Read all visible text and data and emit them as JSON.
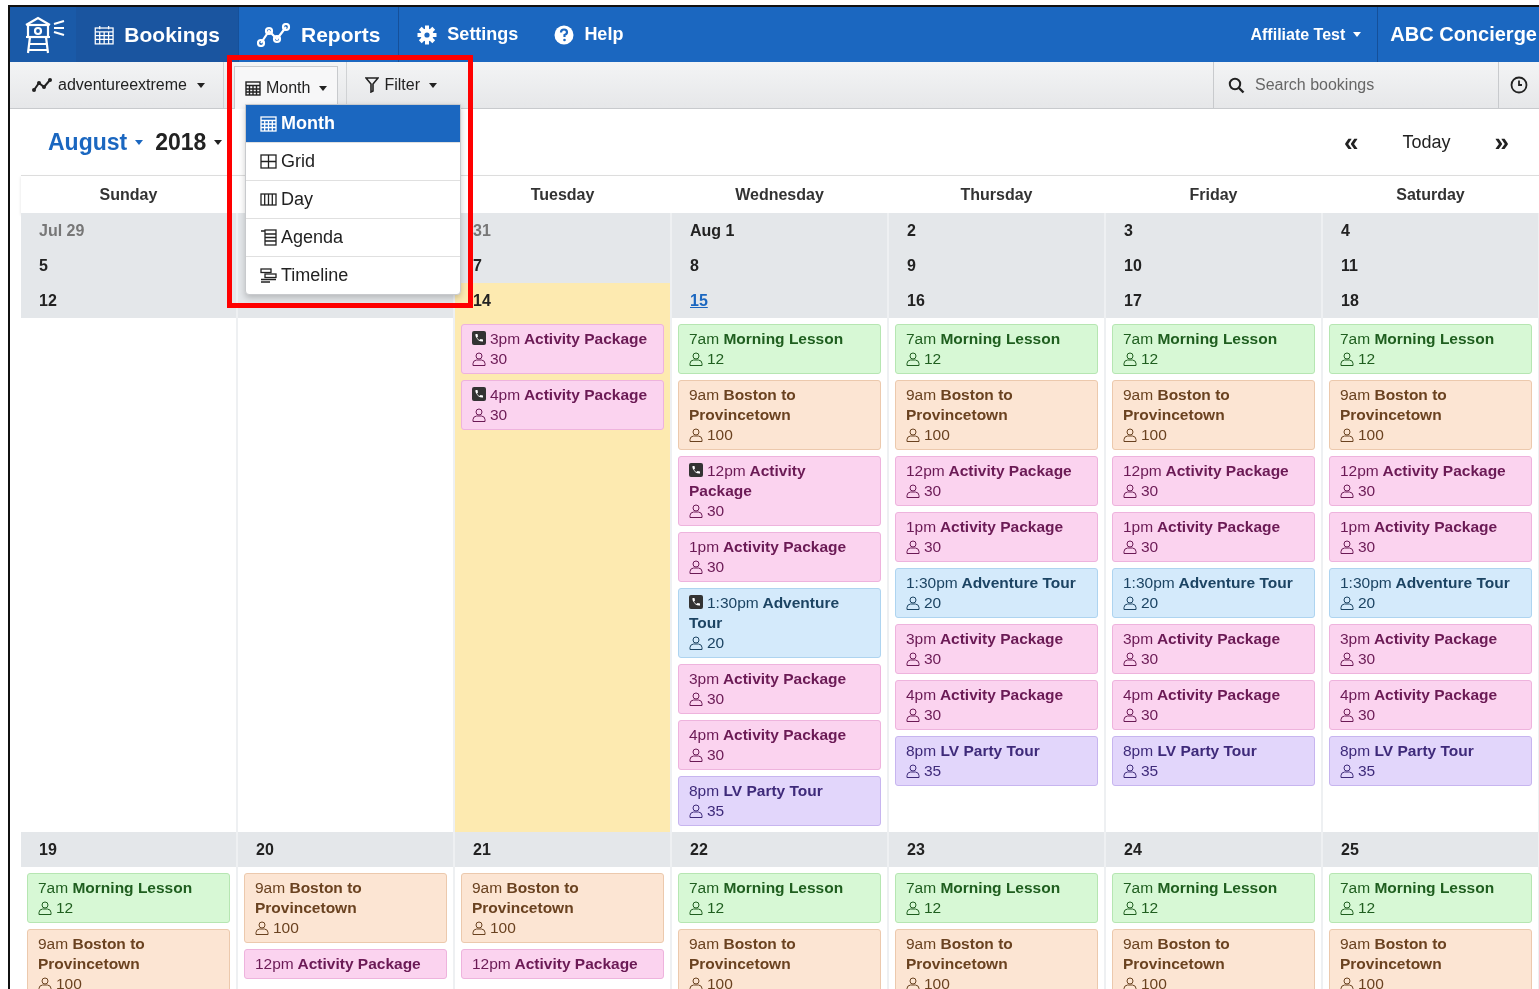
{
  "nav": {
    "items": [
      {
        "label": "Bookings",
        "selected": true
      },
      {
        "label": "Reports",
        "selected": false
      },
      {
        "label": "Settings",
        "selected": false
      },
      {
        "label": "Help",
        "selected": false
      }
    ],
    "account": "Affiliate Test",
    "company": "ABC Concierge"
  },
  "toolbar": {
    "site": "adventureextreme",
    "view_button": "Month",
    "filter_button": "Filter",
    "search": {
      "placeholder": "Search bookings"
    }
  },
  "view_menu": [
    {
      "kind": "month",
      "label": "Month",
      "selected": true
    },
    {
      "kind": "grid",
      "label": "Grid",
      "selected": false
    },
    {
      "kind": "day",
      "label": "Day",
      "selected": false
    },
    {
      "kind": "agenda",
      "label": "Agenda",
      "selected": false
    },
    {
      "kind": "timeline",
      "label": "Timeline",
      "selected": false
    }
  ],
  "calendar": {
    "month": "August",
    "year": "2018",
    "prev": "«",
    "today": "Today",
    "next": "»",
    "weekdays": [
      "Sunday",
      "Tuesday",
      "Wednesday",
      "Thursday",
      "Friday",
      "Saturday"
    ],
    "weeks": [
      {
        "days": [
          {
            "date": "Jul 29",
            "muted": true
          },
          {
            "date": "31",
            "muted": true
          },
          {
            "date": "Aug 1"
          },
          {
            "date": "2"
          },
          {
            "date": "3"
          },
          {
            "date": "4"
          }
        ]
      },
      {
        "days": [
          {
            "date": "5"
          },
          {
            "date": "7"
          },
          {
            "date": "8"
          },
          {
            "date": "9"
          },
          {
            "date": "10"
          },
          {
            "date": "11"
          }
        ]
      },
      {
        "days": [
          {
            "date": "12"
          },
          {
            "date": "14",
            "today": true,
            "events": [
              {
                "kind": "package",
                "phone": true,
                "time": "3pm",
                "title": "Activity Package",
                "count": "30"
              },
              {
                "kind": "package",
                "phone": true,
                "time": "4pm",
                "title": "Activity Package",
                "count": "30"
              }
            ]
          },
          {
            "date": "15",
            "link": true,
            "events": [
              {
                "kind": "lesson",
                "time": "7am",
                "title": "Morning Lesson",
                "count": "12"
              },
              {
                "kind": "transfer",
                "time": "9am",
                "title": "Boston to Provincetown",
                "count": "100"
              },
              {
                "kind": "package",
                "phone": true,
                "time": "12pm",
                "title": "Activity Package",
                "count": "30"
              },
              {
                "kind": "package",
                "time": "1pm",
                "title": "Activity Package",
                "count": "30"
              },
              {
                "kind": "tour",
                "phone": true,
                "time": "1:30pm",
                "title": "Adventure Tour",
                "count": "20"
              },
              {
                "kind": "package",
                "time": "3pm",
                "title": "Activity Package",
                "count": "30"
              },
              {
                "kind": "package",
                "time": "4pm",
                "title": "Activity Package",
                "count": "30"
              },
              {
                "kind": "party",
                "time": "8pm",
                "title": "LV Party Tour",
                "count": "35"
              }
            ]
          },
          {
            "date": "16",
            "events": [
              {
                "kind": "lesson",
                "time": "7am",
                "title": "Morning Lesson",
                "count": "12"
              },
              {
                "kind": "transfer",
                "time": "9am",
                "title": "Boston to Provincetown",
                "count": "100"
              },
              {
                "kind": "package",
                "time": "12pm",
                "title": "Activity Package",
                "count": "30"
              },
              {
                "kind": "package",
                "time": "1pm",
                "title": "Activity Package",
                "count": "30"
              },
              {
                "kind": "tour",
                "time": "1:30pm",
                "title": "Adventure Tour",
                "count": "20"
              },
              {
                "kind": "package",
                "time": "3pm",
                "title": "Activity Package",
                "count": "30"
              },
              {
                "kind": "package",
                "time": "4pm",
                "title": "Activity Package",
                "count": "30"
              },
              {
                "kind": "party",
                "time": "8pm",
                "title": "LV Party Tour",
                "count": "35"
              }
            ]
          },
          {
            "date": "17",
            "events": [
              {
                "kind": "lesson",
                "time": "7am",
                "title": "Morning Lesson",
                "count": "12"
              },
              {
                "kind": "transfer",
                "time": "9am",
                "title": "Boston to Provincetown",
                "count": "100"
              },
              {
                "kind": "package",
                "time": "12pm",
                "title": "Activity Package",
                "count": "30"
              },
              {
                "kind": "package",
                "time": "1pm",
                "title": "Activity Package",
                "count": "30"
              },
              {
                "kind": "tour",
                "time": "1:30pm",
                "title": "Adventure Tour",
                "count": "20"
              },
              {
                "kind": "package",
                "time": "3pm",
                "title": "Activity Package",
                "count": "30"
              },
              {
                "kind": "package",
                "time": "4pm",
                "title": "Activity Package",
                "count": "30"
              },
              {
                "kind": "party",
                "time": "8pm",
                "title": "LV Party Tour",
                "count": "35"
              }
            ]
          },
          {
            "date": "18",
            "events": [
              {
                "kind": "lesson",
                "time": "7am",
                "title": "Morning Lesson",
                "count": "12"
              },
              {
                "kind": "transfer",
                "time": "9am",
                "title": "Boston to Provincetown",
                "count": "100"
              },
              {
                "kind": "package",
                "time": "12pm",
                "title": "Activity Package",
                "count": "30"
              },
              {
                "kind": "package",
                "time": "1pm",
                "title": "Activity Package",
                "count": "30"
              },
              {
                "kind": "tour",
                "time": "1:30pm",
                "title": "Adventure Tour",
                "count": "20"
              },
              {
                "kind": "package",
                "time": "3pm",
                "title": "Activity Package",
                "count": "30"
              },
              {
                "kind": "package",
                "time": "4pm",
                "title": "Activity Package",
                "count": "30"
              },
              {
                "kind": "party",
                "time": "8pm",
                "title": "LV Party Tour",
                "count": "35"
              }
            ]
          }
        ]
      },
      {
        "days": [
          {
            "date": "19",
            "events": [
              {
                "kind": "lesson",
                "time": "7am",
                "title": "Morning Lesson",
                "count": "12"
              },
              {
                "kind": "transfer",
                "time": "9am",
                "title": "Boston to Provincetown",
                "count": "100"
              }
            ]
          },
          {
            "date": "20",
            "events": [
              {
                "kind": "transfer",
                "time": "9am",
                "title": "Boston to Provincetown",
                "count": "100"
              },
              {
                "kind": "package",
                "time": "12pm",
                "title": "Activity Package"
              }
            ]
          },
          {
            "date": "21",
            "events": [
              {
                "kind": "transfer",
                "time": "9am",
                "title": "Boston to Provincetown",
                "count": "100"
              },
              {
                "kind": "package",
                "time": "12pm",
                "title": "Activity Package"
              }
            ]
          },
          {
            "date": "22",
            "events": [
              {
                "kind": "lesson",
                "time": "7am",
                "title": "Morning Lesson",
                "count": "12"
              },
              {
                "kind": "transfer",
                "time": "9am",
                "title": "Boston to Provincetown",
                "count": "100"
              }
            ]
          },
          {
            "date": "23",
            "events": [
              {
                "kind": "lesson",
                "time": "7am",
                "title": "Morning Lesson",
                "count": "12"
              },
              {
                "kind": "transfer",
                "time": "9am",
                "title": "Boston to Provincetown",
                "count": "100"
              }
            ]
          },
          {
            "date": "24",
            "events": [
              {
                "kind": "lesson",
                "time": "7am",
                "title": "Morning Lesson",
                "count": "12"
              },
              {
                "kind": "transfer",
                "time": "9am",
                "title": "Boston to Provincetown",
                "count": "100"
              }
            ]
          },
          {
            "date": "25",
            "events": [
              {
                "kind": "lesson",
                "time": "7am",
                "title": "Morning Lesson",
                "count": "12"
              },
              {
                "kind": "transfer",
                "time": "9am",
                "title": "Boston to Provincetown",
                "count": "100"
              }
            ]
          }
        ]
      }
    ]
  }
}
